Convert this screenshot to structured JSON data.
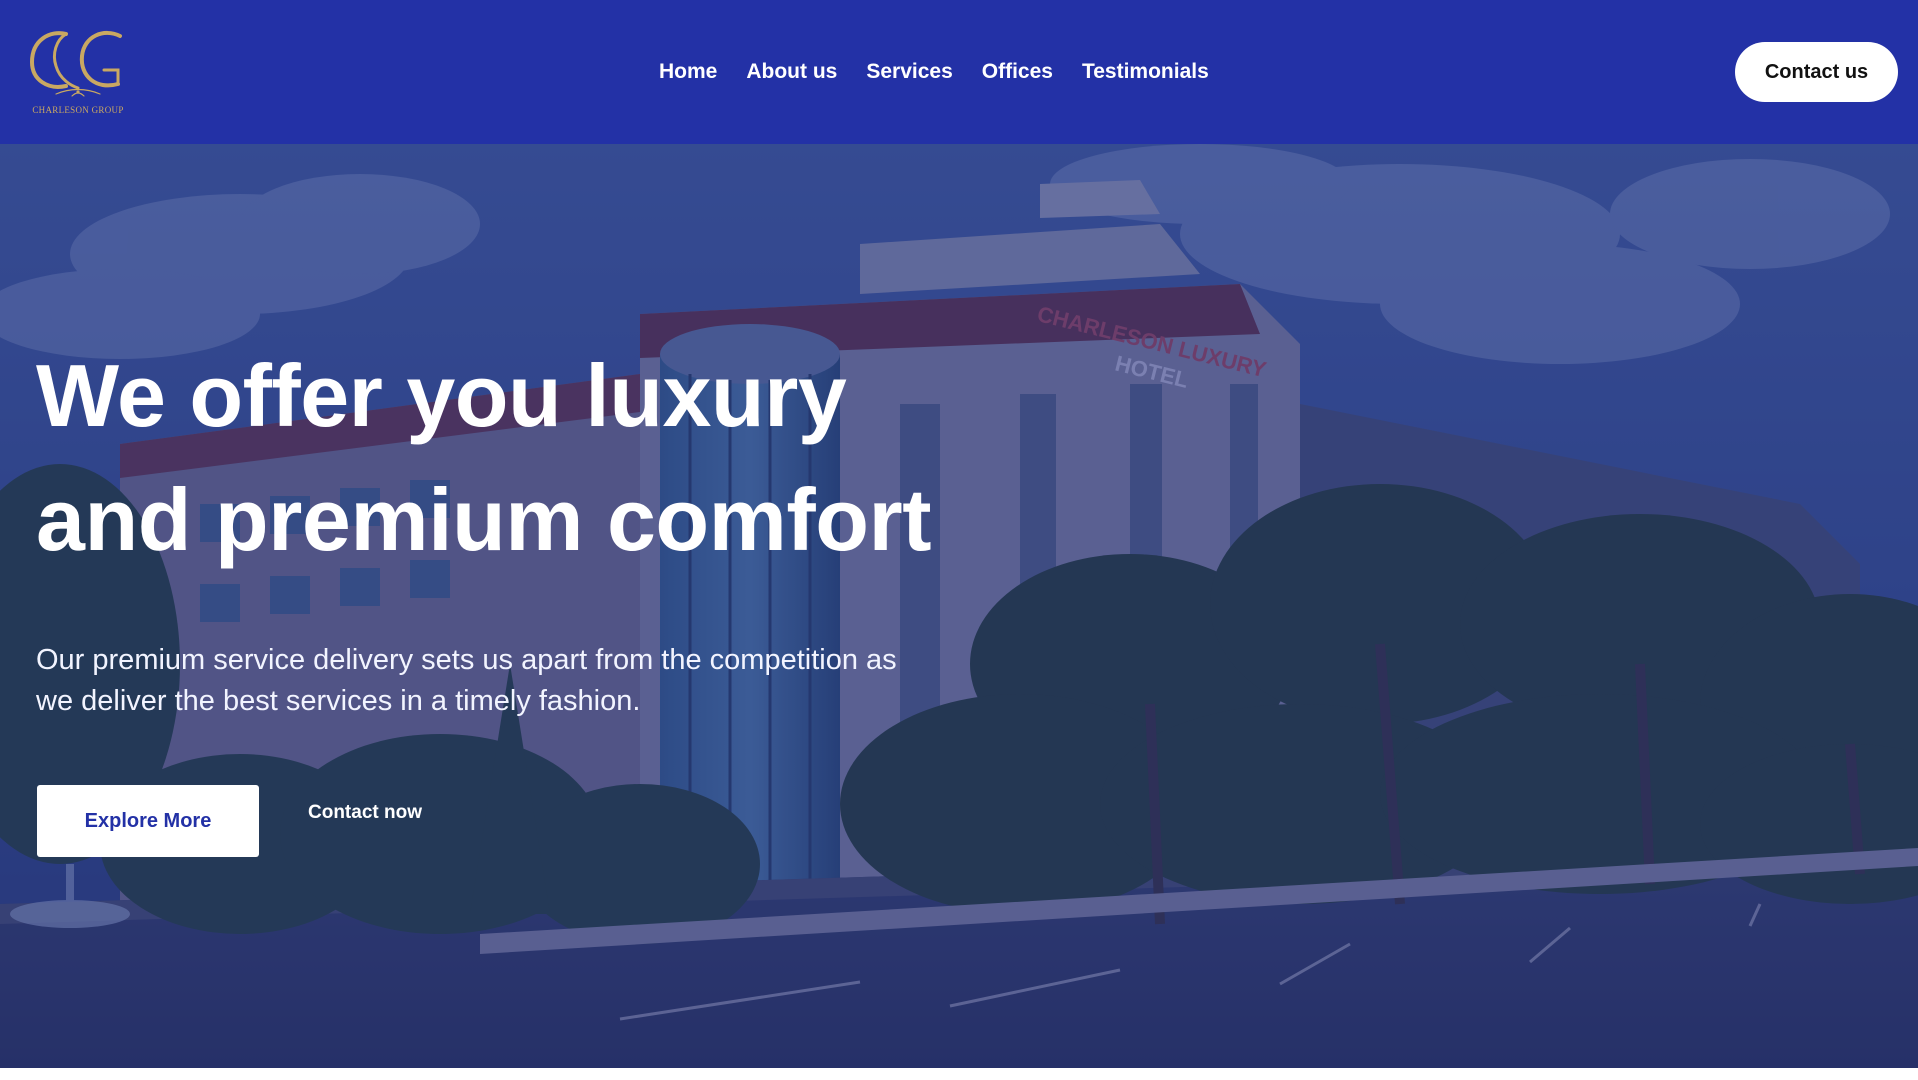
{
  "brand": {
    "logo_text": "CHARLESON GROUP",
    "logo_icon": "cg-monogram-logo",
    "gold_color": "#c9a862"
  },
  "nav": {
    "items": [
      {
        "label": "Home"
      },
      {
        "label": "About us"
      },
      {
        "label": "Services"
      },
      {
        "label": "Offices"
      },
      {
        "label": "Testimonials"
      }
    ],
    "contact_button": "Contact us"
  },
  "hero": {
    "title_line1": "We offer you luxury",
    "title_line2": "and premium comfort",
    "subtitle_line1": "Our premium service delivery sets us apart from the competition as",
    "subtitle_line2": "we deliver the best services in a timely fashion.",
    "primary_button": "Explore More",
    "secondary_link": "Contact now",
    "building_sign_line1": "CHARLESON LUXURY",
    "building_sign_line2": "HOTEL"
  },
  "colors": {
    "nav_background": "#2331a6",
    "overlay": "#1c2678",
    "button_text": "#2331a6",
    "white": "#ffffff"
  }
}
